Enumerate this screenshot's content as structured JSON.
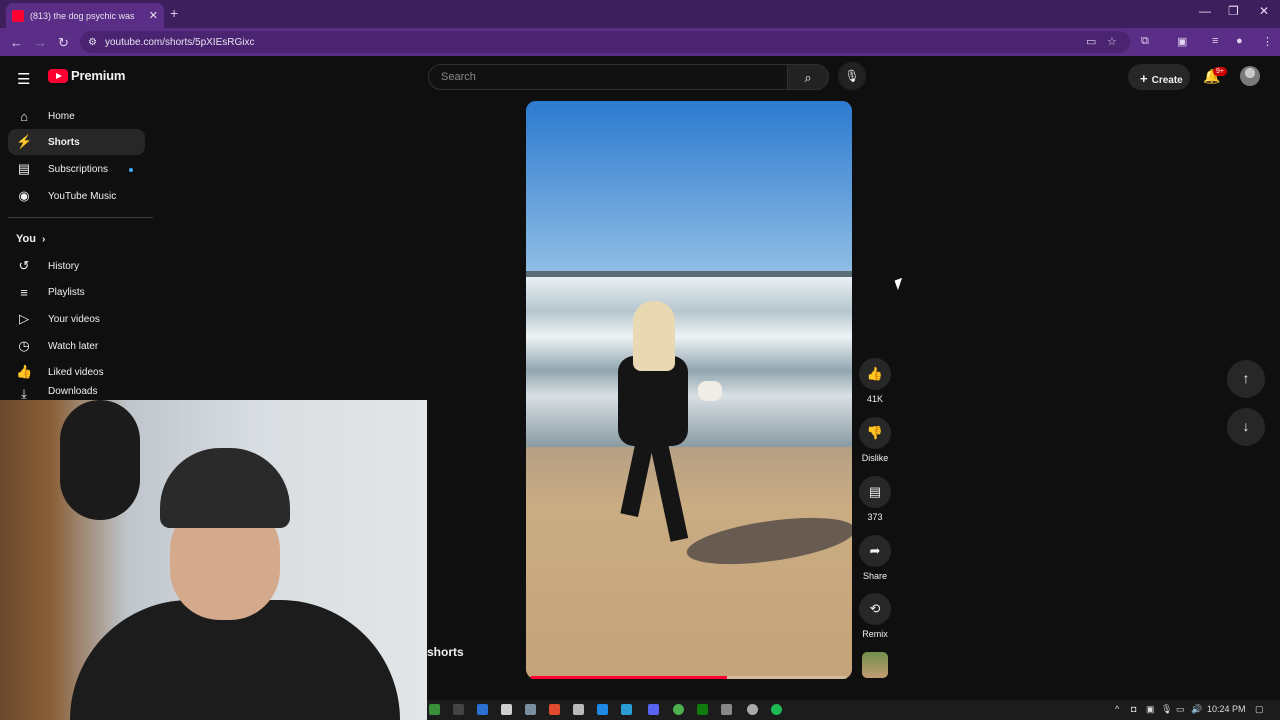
{
  "browser": {
    "tab_title": "(813) the dog psychic was",
    "tab_close": "✕",
    "new_tab": "+",
    "url": "youtube.com/shorts/5pXIEsRGixc",
    "window_controls": [
      "—",
      "❐",
      "✕"
    ]
  },
  "header": {
    "logo_text": "Premium",
    "search_placeholder": "Search",
    "create_label": "Create",
    "notification_count": "9+"
  },
  "sidebar": {
    "items": [
      {
        "label": "Home",
        "icon": "home-icon"
      },
      {
        "label": "Shorts",
        "icon": "shorts-icon"
      },
      {
        "label": "Subscriptions",
        "icon": "subscriptions-icon"
      },
      {
        "label": "YouTube Music",
        "icon": "music-icon"
      }
    ],
    "you_label": "You",
    "you_items": [
      {
        "label": "History",
        "icon": "history-icon"
      },
      {
        "label": "Playlists",
        "icon": "playlists-icon"
      },
      {
        "label": "Your videos",
        "icon": "your-videos-icon"
      },
      {
        "label": "Watch later",
        "icon": "watch-later-icon"
      },
      {
        "label": "Liked videos",
        "icon": "liked-icon"
      },
      {
        "label": "Downloads",
        "icon": "download-icon"
      }
    ]
  },
  "short": {
    "progress": 0.62,
    "likes": "41K",
    "dislike_label": "Dislike",
    "comments": "373",
    "share_label": "Share",
    "remix_label": "Remix"
  },
  "overlay": {
    "shorts_label": "shorts"
  },
  "taskbar": {
    "time": "10:24 PM"
  },
  "colors": {
    "accent": "#ff0033",
    "browser_frame": "#5a2e86",
    "background": "#0f0f0f"
  }
}
